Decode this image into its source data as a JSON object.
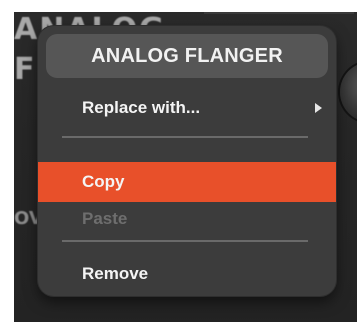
{
  "background": {
    "title_line_1": "ANALOG",
    "title_line_2": "FL",
    "side_label": "OV"
  },
  "context_menu": {
    "title": "ANALOG FLANGER",
    "items": [
      {
        "label": "Replace with...",
        "has_submenu": true,
        "enabled": true,
        "highlighted": false
      },
      {
        "label": "Copy",
        "has_submenu": false,
        "enabled": true,
        "highlighted": true
      },
      {
        "label": "Paste",
        "has_submenu": false,
        "enabled": false,
        "highlighted": false
      },
      {
        "label": "Remove",
        "has_submenu": false,
        "enabled": true,
        "highlighted": false
      }
    ]
  },
  "colors": {
    "menu_background": "#3c3c3c",
    "header_background": "#565656",
    "highlight": "#e8502a",
    "disabled_text": "#6e6e6e",
    "text": "#f4f4f4"
  },
  "icons": {
    "submenu": "chevron-right-icon"
  }
}
